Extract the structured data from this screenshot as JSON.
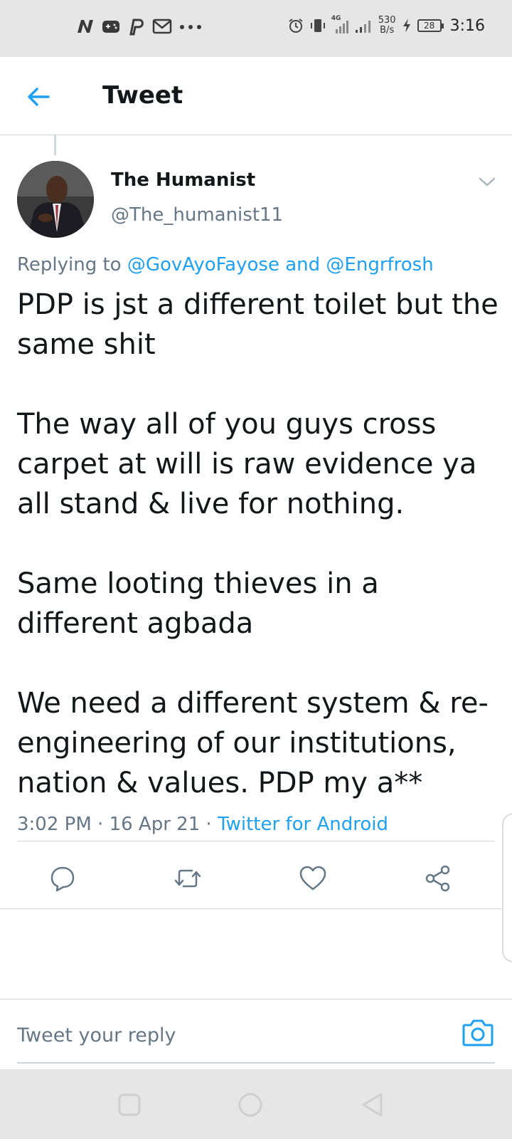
{
  "status_bar": {
    "net_speed_value": "530",
    "net_speed_unit": "B/s",
    "network_type": "4G",
    "battery": "28",
    "time": "3:16"
  },
  "header": {
    "title": "Tweet"
  },
  "tweet": {
    "author_name": "The Humanist",
    "author_handle": "@The_humanist11",
    "replying_prefix": "Replying to",
    "replying_user1": "@GovAyoFayose",
    "replying_and": "and",
    "replying_user2": "@Engrfrosh",
    "paragraphs": [
      "PDP is jst a different toilet but the same shit",
      "The way all of you guys cross carpet at will is raw evidence ya all stand & live for nothing.",
      "Same looting thieves in a different agbada",
      "We need a different system & re-engineering of our institutions, nation & values. PDP my a**"
    ],
    "time": "3:02 PM",
    "separator": "·",
    "date": "16 Apr 21",
    "source": "Twitter for Android"
  },
  "reply": {
    "placeholder": "Tweet your reply"
  },
  "colors": {
    "accent": "#1da1f2",
    "secondary_text": "#657786",
    "primary_text": "#14171a"
  },
  "icons": {
    "back": "arrow-left-icon",
    "caret": "chevron-down-icon",
    "reply": "comment-icon",
    "retweet": "retweet-icon",
    "like": "heart-icon",
    "share": "share-icon",
    "camera": "camera-icon"
  }
}
